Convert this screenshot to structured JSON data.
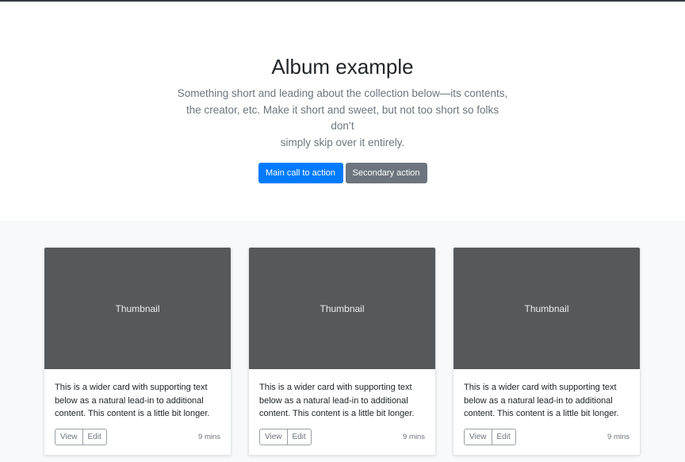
{
  "hero": {
    "title": "Album example",
    "lead_lines": [
      "Something short and leading about the collection below—its contents,",
      "the creator, etc. Make it short and sweet, but not too short so folks don’t",
      "simply skip over it entirely."
    ],
    "primary_label": "Main call to action",
    "secondary_label": "Secondary action"
  },
  "cards": [
    {
      "thumb_label": "Thumbnail",
      "text_lines": [
        "This is a wider card with supporting text",
        "below as a natural lead-in to additional",
        "content. This content is a little bit longer."
      ],
      "view_label": "View",
      "edit_label": "Edit",
      "time": "9 mins"
    },
    {
      "thumb_label": "Thumbnail",
      "text_lines": [
        "This is a wider card with supporting text",
        "below as a natural lead-in to additional",
        "content. This content is a little bit longer."
      ],
      "view_label": "View",
      "edit_label": "Edit",
      "time": "9 mins"
    },
    {
      "thumb_label": "Thumbnail",
      "text_lines": [
        "This is a wider card with supporting text",
        "below as a natural lead-in to additional",
        "content. This content is a little bit longer."
      ],
      "view_label": "View",
      "edit_label": "Edit",
      "time": "9 mins"
    }
  ],
  "colors": {
    "primary": "#007bff",
    "secondary": "#6c757d",
    "thumbnail_bg": "#55595c",
    "album_bg": "#f8f9fa"
  }
}
